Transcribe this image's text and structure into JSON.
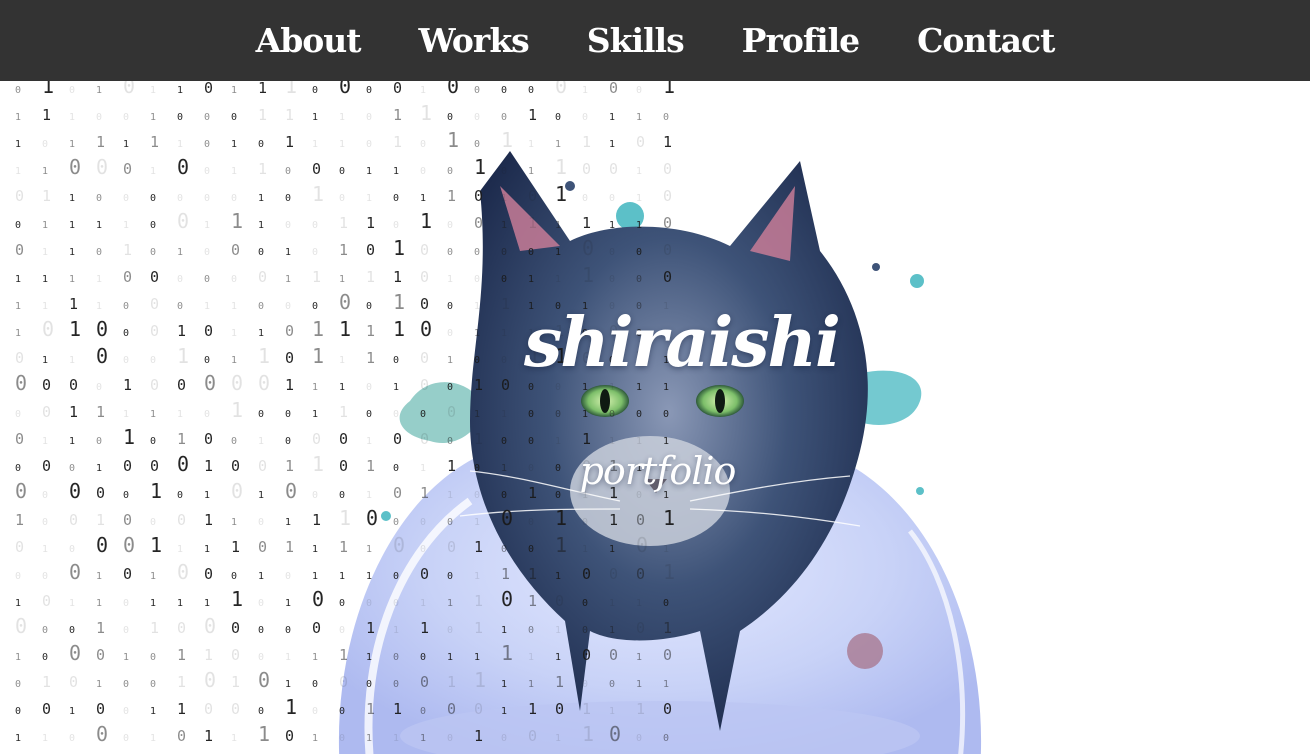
{
  "nav": {
    "items": [
      {
        "label": "About"
      },
      {
        "label": "Works"
      },
      {
        "label": "Skills"
      },
      {
        "label": "Profile"
      },
      {
        "label": "Contact"
      }
    ]
  },
  "hero": {
    "title": "shiraishi",
    "subtitle": "portfolio",
    "rain_digits": [
      "0",
      "1"
    ]
  },
  "colors": {
    "nav_background": "#333333",
    "nav_text": "#ffffff",
    "page_background": "#ffffff",
    "rain_digit": "#1a1a1a",
    "cat_fur": "#3e5378",
    "cat_eyes": "#7dbf6a",
    "watercolor_blob": "#c8d2f7",
    "splash_teal": "#5cc0c8"
  }
}
